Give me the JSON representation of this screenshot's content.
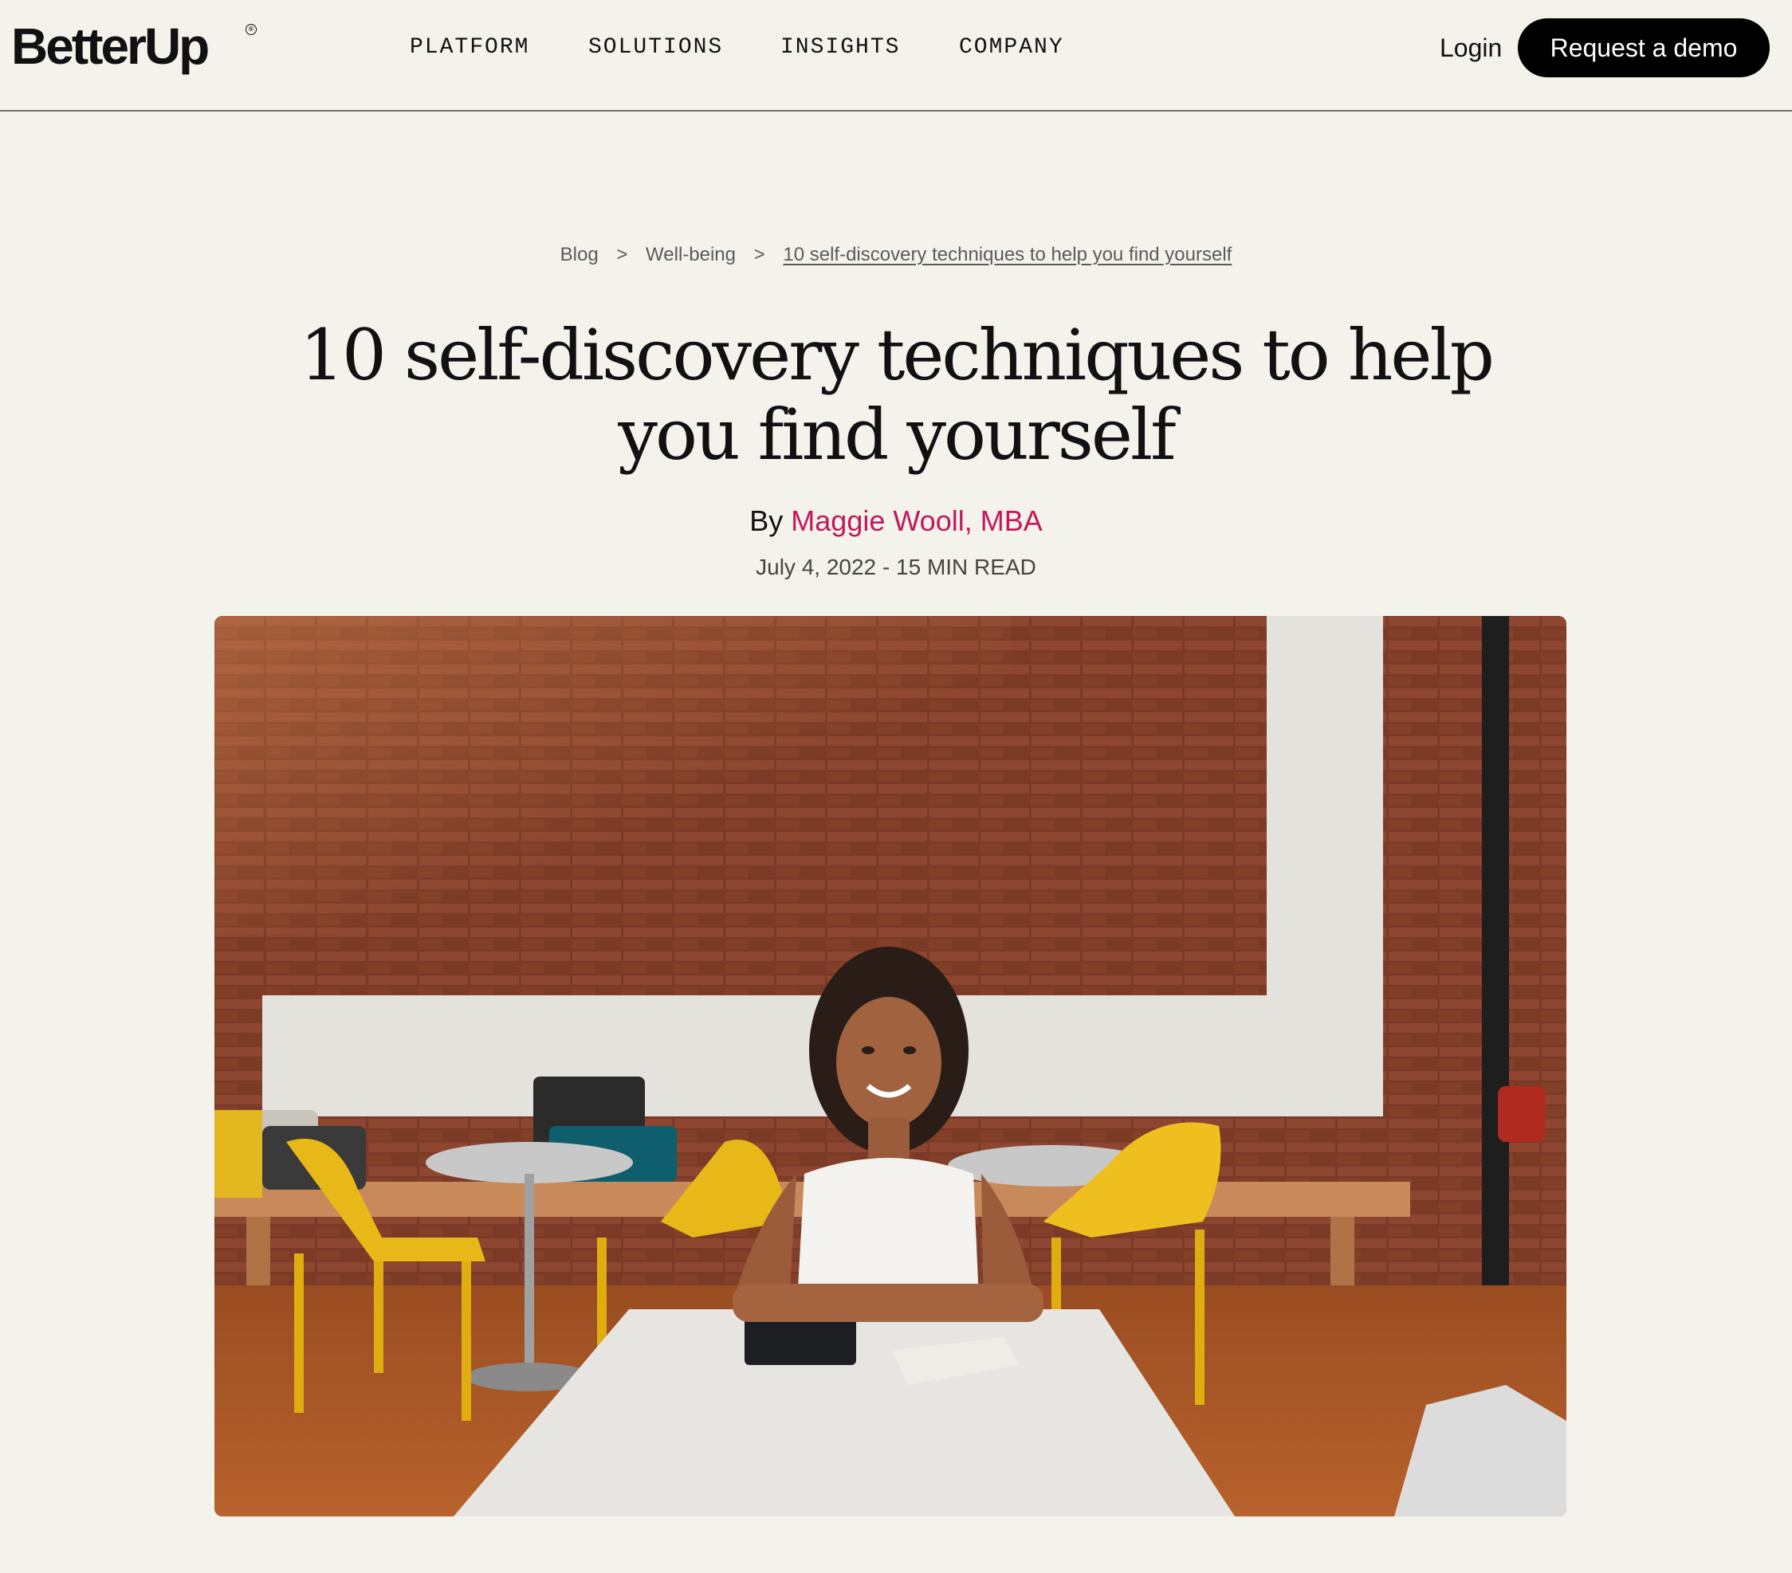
{
  "header": {
    "logo_text": "BetterUp",
    "logo_mark": "®",
    "nav": [
      {
        "label": "PLATFORM"
      },
      {
        "label": "SOLUTIONS"
      },
      {
        "label": "INSIGHTS"
      },
      {
        "label": "COMPANY"
      }
    ],
    "login_label": "Login",
    "demo_label": "Request a demo"
  },
  "breadcrumb": {
    "items": [
      "Blog",
      "Well-being",
      "10 self-discovery techniques to help you find yourself"
    ],
    "separator": ">"
  },
  "article": {
    "title": "10 self-discovery techniques to help you find yourself",
    "by_label": "By",
    "author": "Maggie Wooll, MBA",
    "meta": "July 4, 2022 - 15 MIN READ"
  },
  "colors": {
    "background": "#f3f2eb",
    "author_link": "#c2185b",
    "button_bg": "#000000"
  }
}
